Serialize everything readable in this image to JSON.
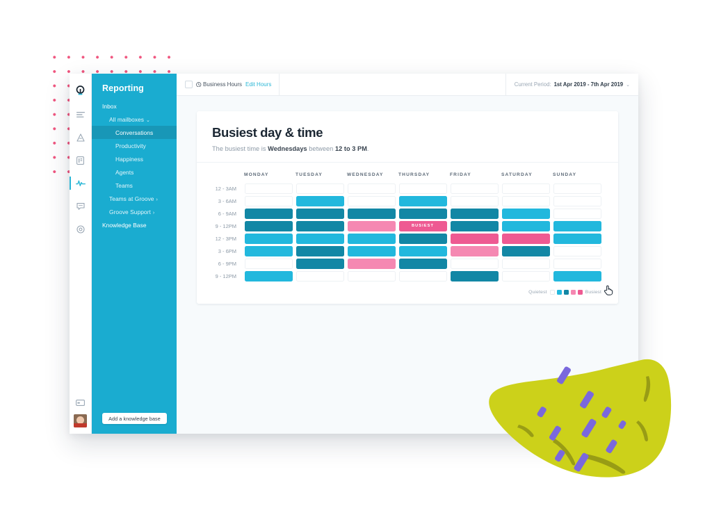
{
  "window": {
    "title": "Reporting"
  },
  "icon_rail": {
    "items": [
      {
        "name": "groove-logo-icon",
        "label": "Groove",
        "active": false
      },
      {
        "name": "inbox-list-icon",
        "label": "Inbox",
        "active": false
      },
      {
        "name": "knowledge-base-icon",
        "label": "Knowledge Base",
        "active": false
      },
      {
        "name": "docs-icon",
        "label": "Docs",
        "active": false
      },
      {
        "name": "reporting-pulse-icon",
        "label": "Reporting",
        "active": true
      },
      {
        "name": "chat-bubble-icon",
        "label": "Chat",
        "active": false
      },
      {
        "name": "settings-gear-icon",
        "label": "Settings",
        "active": false
      }
    ],
    "bottom": [
      {
        "name": "card-icon",
        "label": "Billing"
      },
      {
        "name": "avatar",
        "label": "Account"
      }
    ]
  },
  "sidebar": {
    "title": "Reporting",
    "items": [
      {
        "label": "Inbox",
        "level": 1,
        "selected": false,
        "chevron": "",
        "strong": true
      },
      {
        "label": "All mailboxes",
        "level": 2,
        "selected": false,
        "chevron": "⌄",
        "strong": false
      },
      {
        "label": "Conversations",
        "level": 3,
        "selected": true,
        "chevron": "",
        "strong": false
      },
      {
        "label": "Productivity",
        "level": 3,
        "selected": false,
        "chevron": "",
        "strong": false
      },
      {
        "label": "Happiness",
        "level": 3,
        "selected": false,
        "chevron": "",
        "strong": false
      },
      {
        "label": "Agents",
        "level": 3,
        "selected": false,
        "chevron": "",
        "strong": false
      },
      {
        "label": "Teams",
        "level": 3,
        "selected": false,
        "chevron": "",
        "strong": false
      },
      {
        "label": "Teams at Groove",
        "level": 2,
        "selected": false,
        "chevron": "›",
        "strong": false
      },
      {
        "label": "Groove Support",
        "level": 2,
        "selected": false,
        "chevron": "›",
        "strong": false
      },
      {
        "label": "Knowledge Base",
        "level": 1,
        "selected": false,
        "chevron": "",
        "strong": true
      }
    ],
    "add_kb_button": "Add a knowledge base"
  },
  "topbar": {
    "business_hours_label": "Business Hours",
    "edit_hours_label": "Edit Hours",
    "business_hours_checked": false,
    "period_label": "Current Period:",
    "period_value": "1st Apr 2019  -  7th Apr 2019",
    "period_chevron": "⌄"
  },
  "legend": {
    "low_label": "Quietest",
    "high_label": "Busiest",
    "levels": [
      0,
      1,
      2,
      3,
      4
    ]
  },
  "colors": {
    "sidebar_blue": "#1aacd0",
    "sidebar_selected": "#1897b7",
    "accent_link": "#2bb7d6",
    "level_0": "#ffffff",
    "level_1": "#22b8dd",
    "level_2": "#1287a5",
    "level_3": "#f588b2",
    "level_4": "#ee5a92",
    "dot_pattern": "#f0567f",
    "blob_green": "#ccd11a",
    "blob_dash_purple": "#7a68dd"
  },
  "chart_data": {
    "type": "heatmap",
    "title": "Busiest day & time",
    "subtitle_parts": {
      "pre": "The busiest time is ",
      "day": "Wednesdays",
      "mid": " between ",
      "time": "12 to 3 PM",
      "post": "."
    },
    "subtitle": "The busiest time is Wednesdays between 12 to 3 PM.",
    "xlabel": "",
    "ylabel": "",
    "categories": [
      "MONDAY",
      "TUESDAY",
      "WEDNESDAY",
      "THURSDAY",
      "FRIDAY",
      "SATURDAY",
      "SUNDAY"
    ],
    "rows": [
      "12 - 3AM",
      "3 - 6AM",
      "6 - 9AM",
      "9 - 12PM",
      "12 - 3PM",
      "3 - 6PM",
      "6 - 9PM",
      "9 - 12PM"
    ],
    "scale": {
      "0": "none / quietest",
      "1": "low",
      "2": "medium",
      "3": "high",
      "4": "busiest"
    },
    "values": [
      [
        0,
        0,
        0,
        0,
        0,
        0,
        0
      ],
      [
        0,
        1,
        0,
        1,
        0,
        0,
        0
      ],
      [
        2,
        2,
        2,
        2,
        2,
        1,
        0
      ],
      [
        2,
        2,
        3,
        4,
        2,
        1,
        1
      ],
      [
        1,
        1,
        1,
        2,
        4,
        4,
        1
      ],
      [
        1,
        2,
        1,
        1,
        3,
        2,
        0
      ],
      [
        0,
        2,
        3,
        2,
        0,
        0,
        0
      ],
      [
        1,
        0,
        0,
        0,
        2,
        0,
        1
      ]
    ],
    "busiest_cell": {
      "row": 3,
      "col": 3,
      "label": "BUSIEST"
    },
    "hovered_cell": {
      "row": 2,
      "col": 5
    },
    "legend_position": "bottom-right",
    "grid": true
  }
}
